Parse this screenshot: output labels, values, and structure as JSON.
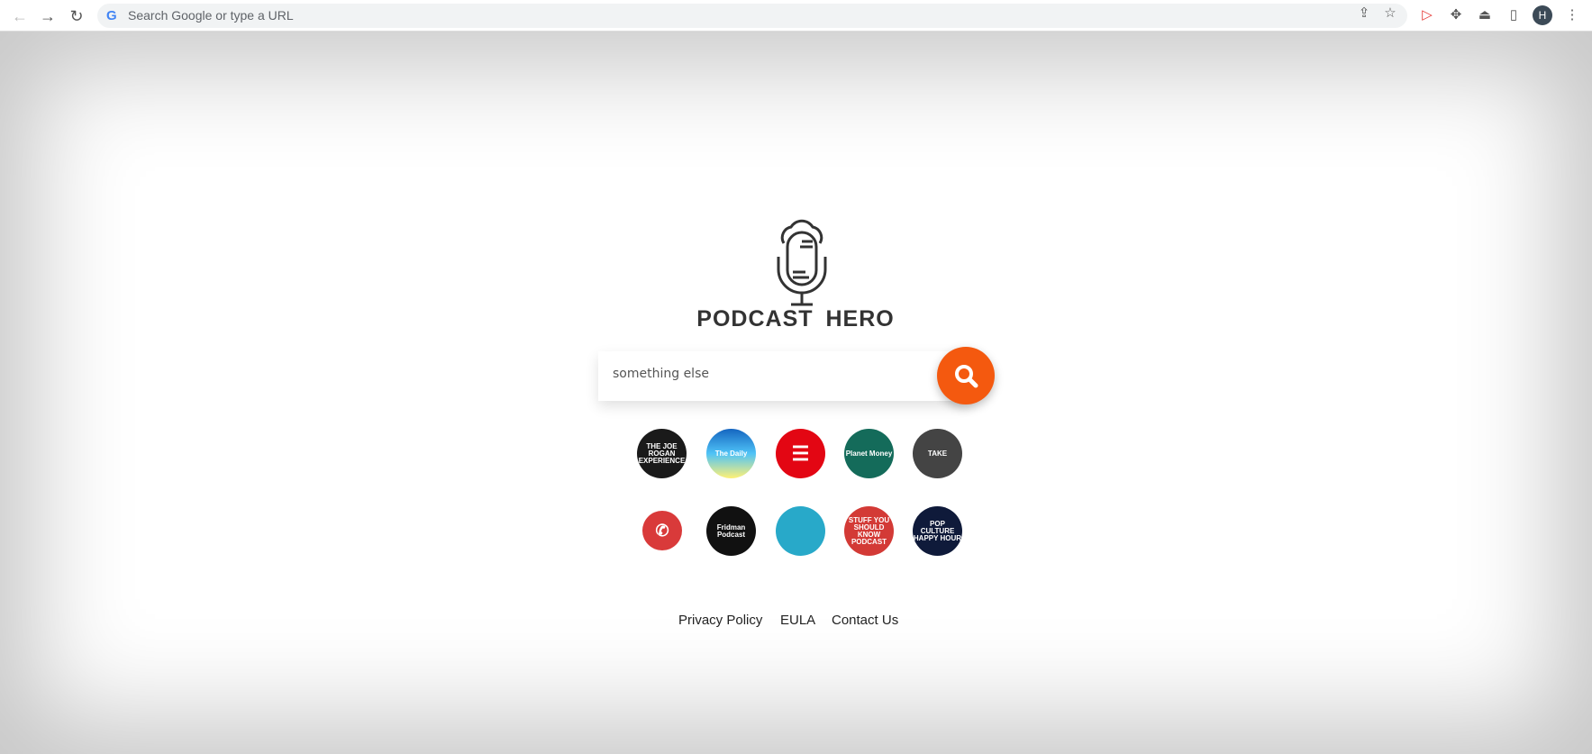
{
  "browser": {
    "omnibox_placeholder": "Search Google or type a URL",
    "profile_initial": "H"
  },
  "brand": {
    "name": "PODCAST HERO",
    "accent": "#f4590f"
  },
  "search": {
    "value": "something else"
  },
  "podcasts": [
    {
      "label": "THE JOE ROGAN EXPERIENCE",
      "color": "#1a1a1a"
    },
    {
      "label": "The Daily",
      "color": "#1e88e5"
    },
    {
      "label": "",
      "color": "#e30613"
    },
    {
      "label": "Planet Money",
      "color": "#146b5a"
    },
    {
      "label": "TAKE",
      "color": "#444"
    },
    {
      "label": "",
      "color": "#d93a3a"
    },
    {
      "label": "Fridman Podcast",
      "color": "#111"
    },
    {
      "label": "",
      "color": "#28a9c9"
    },
    {
      "label": "STUFF YOU SHOULD KNOW PODCAST",
      "color": "#d33a36"
    },
    {
      "label": "POP CULTURE HAPPY HOUR",
      "color": "#0f1a3a"
    }
  ],
  "footer": {
    "privacy": "Privacy Policy",
    "eula": "EULA",
    "contact": "Contact Us"
  }
}
